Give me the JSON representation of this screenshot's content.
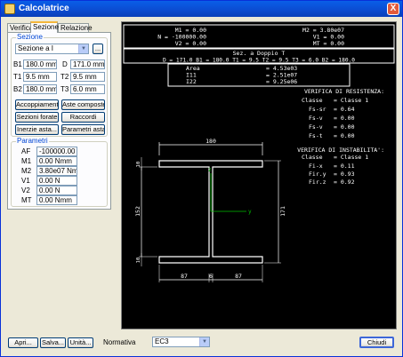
{
  "window": {
    "title": "Calcolatrice",
    "close_glyph": "X"
  },
  "tabs": [
    {
      "label": "Verifica"
    },
    {
      "label": "Sezione"
    },
    {
      "label": "Relazione"
    }
  ],
  "sezione": {
    "group_title": "Sezione",
    "type_select": "Sezione a I",
    "browse_label": "...",
    "fields": {
      "B1": {
        "label": "B1",
        "value": "180.0 mm"
      },
      "D": {
        "label": "D",
        "value": "171.0 mm"
      },
      "T1": {
        "label": "T1",
        "value": "9.5 mm"
      },
      "T2": {
        "label": "T2",
        "value": "9.5 mm"
      },
      "B2": {
        "label": "B2",
        "value": "180.0 mm"
      },
      "T3": {
        "label": "T3",
        "value": "6.0 mm"
      }
    },
    "buttons": {
      "accoppiamento": "Accoppiamento",
      "aste_composte": "Aste composte",
      "sezioni_forate": "Sezioni forate",
      "raccordi": "Raccordi",
      "inerzie_asta": "Inerzie asta...",
      "parametri_asta": "Parametri asta..."
    }
  },
  "parametri": {
    "group_title": "Parametri",
    "fields": {
      "AF": {
        "label": "AF",
        "value": "-100000.00 N"
      },
      "M1": {
        "label": "M1",
        "value": "0.00 Nmm"
      },
      "M2": {
        "label": "M2",
        "value": "3.80e07 Nmm"
      },
      "V1": {
        "label": "V1",
        "value": "0.00 N"
      },
      "V2": {
        "label": "V2",
        "value": "0.00 N"
      },
      "MT": {
        "label": "MT",
        "value": "0.00 Nmm"
      }
    }
  },
  "display": {
    "top_left": [
      "M1 = 0.00",
      "N = -100000.00",
      "V2 = 0.00"
    ],
    "top_right": [
      "M2 = 3.80e07",
      "V1 = 0.00",
      "MT = 0.00"
    ],
    "section_title": "Sez. a Doppio T",
    "section_dims": "D = 171.0  B1 = 180.0  T1 = 9.5  T2 = 9.5  T3 = 6.0  B2 = 180.0",
    "props": [
      {
        "name": "Area",
        "value": "= 4.53e03"
      },
      {
        "name": "I11",
        "value": "= 2.51e07"
      },
      {
        "name": "I22",
        "value": "= 9.25e06"
      }
    ],
    "resistenza": {
      "title": "VERIFICA DI RESISTENZA:",
      "rows": [
        {
          "name": "Classe",
          "value": "= Classe 1"
        },
        {
          "name": "Fs-sr",
          "value": "= 0.64"
        },
        {
          "name": "Fs-v",
          "value": "= 0.00"
        },
        {
          "name": "Fs-v",
          "value": "= 0.00"
        },
        {
          "name": "Fs-t",
          "value": "= 0.00"
        }
      ]
    },
    "instabilita": {
      "title": "VERIFICA DI INSTABILITA':",
      "rows": [
        {
          "name": "Classe",
          "value": "= Classe 1"
        },
        {
          "name": "Fi-x",
          "value": "= 0.11"
        },
        {
          "name": "Fir.y",
          "value": "= 0.93"
        },
        {
          "name": "Fir.z",
          "value": "= 0.92"
        }
      ]
    },
    "drawing": {
      "dim_top": "180",
      "dim_left": "152",
      "dim_right": "171",
      "dim_flange_top": "10",
      "dim_flange_bottom": "10",
      "dim_bottom_left": "87",
      "dim_bottom_web": "6",
      "dim_bottom_right": "87",
      "axis_y": "y",
      "axis_z": "z"
    }
  },
  "bottom": {
    "apri": "Apri...",
    "salva": "Salva...",
    "unita": "Unità...",
    "normativa_label": "Normativa",
    "normativa_value": "EC3",
    "chiudi": "Chiudi"
  },
  "colors": {
    "titlebar": "#0B4BD0",
    "display_bg": "#000000",
    "display_text": "#FFFFFF",
    "axis": "#00C000",
    "group_title": "#0046D5"
  }
}
